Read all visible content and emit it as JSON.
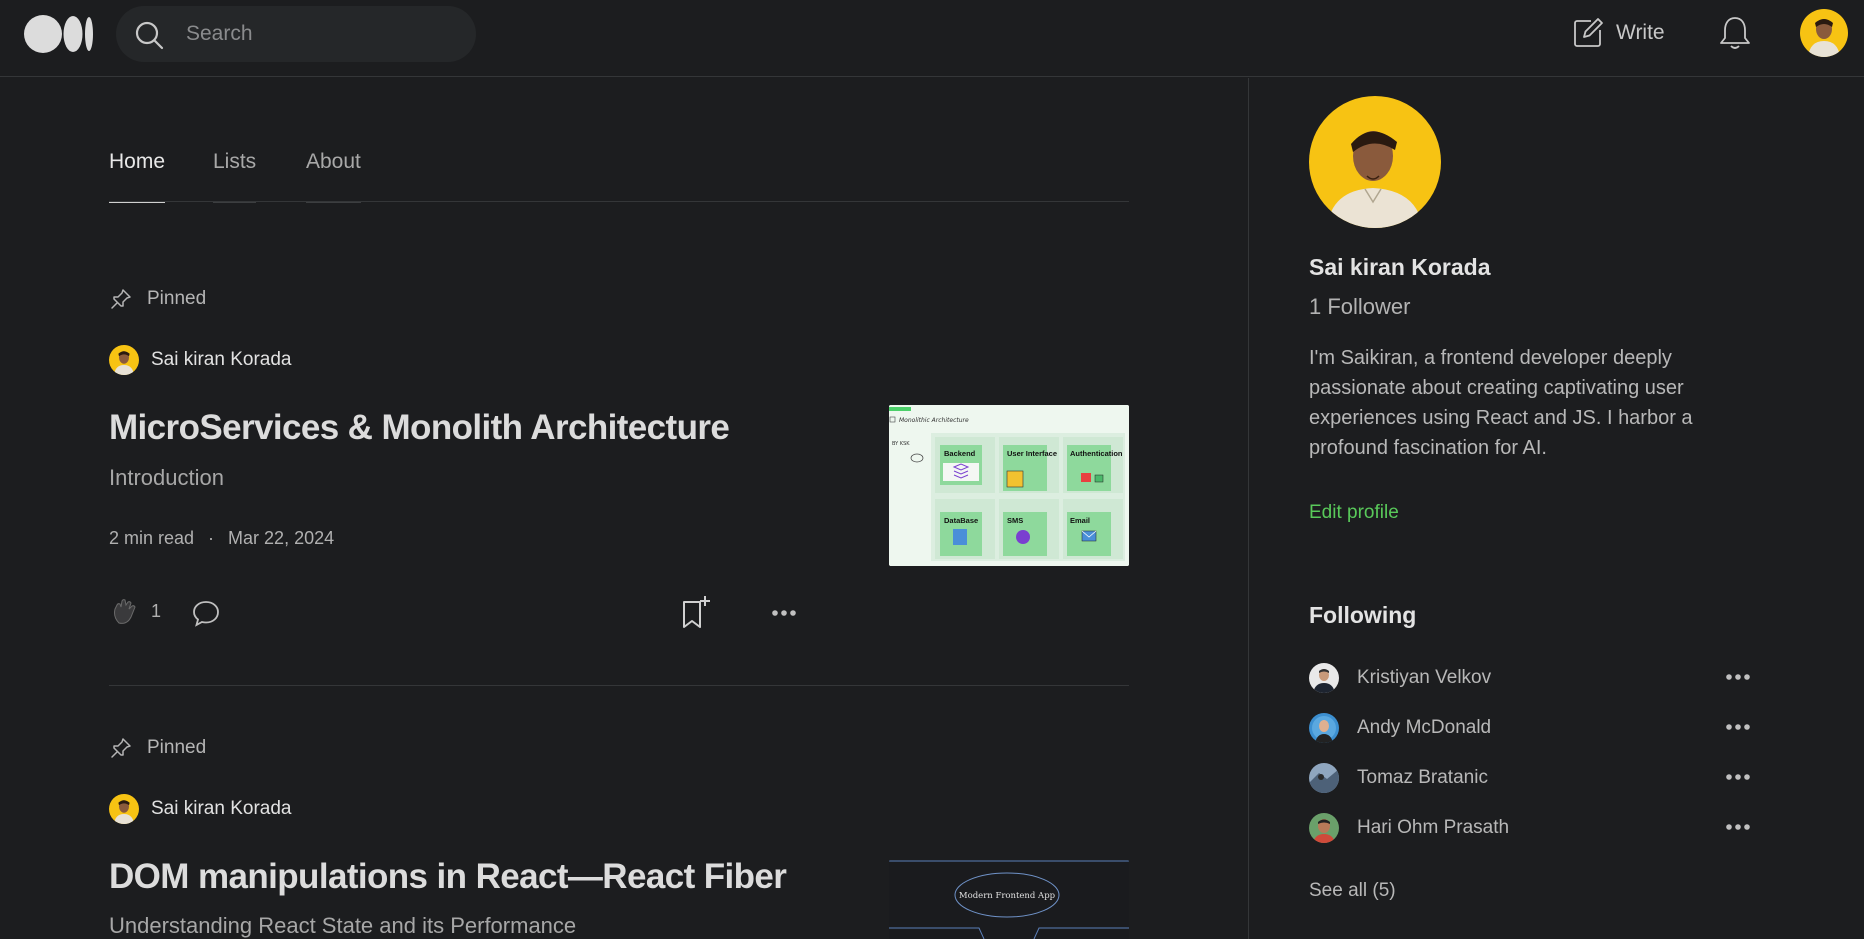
{
  "header": {
    "search_placeholder": "Search",
    "write_label": "Write"
  },
  "tabs": [
    {
      "label": "Home",
      "active": true
    },
    {
      "label": "Lists",
      "active": false
    },
    {
      "label": "About",
      "active": false
    }
  ],
  "articles": [
    {
      "pinned_label": "Pinned",
      "author": "Sai kiran Korada",
      "title": "MicroServices & Monolith Architecture",
      "subtitle": "Introduction",
      "read_time": "2 min read",
      "separator": "·",
      "date": "Mar 22, 2024",
      "claps": "1",
      "thumbnail": {
        "heading": "Monolithic Architecture",
        "side_note": "BY KSK",
        "tiles": [
          "Backend",
          "User Interface",
          "Authentication",
          "DataBase",
          "SMS",
          "Email"
        ]
      }
    },
    {
      "pinned_label": "Pinned",
      "author": "Sai kiran Korada",
      "title": "DOM manipulations in React—React Fiber",
      "subtitle": "Understanding React State and its Performance",
      "thumbnail": {
        "label": "Modern Frontend App"
      }
    }
  ],
  "profile": {
    "name": "Sai kiran Korada",
    "followers": "1 Follower",
    "bio": "I'm Saikiran, a frontend developer deeply passionate about creating captivating user experiences using React and JS. I harbor a profound fascination for AI.",
    "edit_label": "Edit profile"
  },
  "following": {
    "heading": "Following",
    "people": [
      {
        "name": "Kristiyan Velkov"
      },
      {
        "name": "Andy McDonald"
      },
      {
        "name": "Tomaz Bratanic"
      },
      {
        "name": "Hari Ohm Prasath"
      }
    ],
    "see_all": "See all (5)"
  },
  "colors": {
    "background": "#1c1d1f",
    "accent_green": "#59c95a",
    "avatar_yellow": "#f7c313"
  }
}
